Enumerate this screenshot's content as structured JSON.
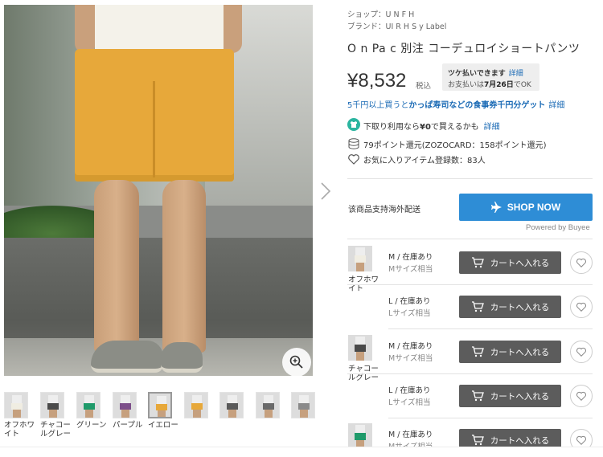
{
  "shop": {
    "label": "ショップ：",
    "value": "U N F H"
  },
  "brand": {
    "label": "ブランド：",
    "value": "UI R H S y Label"
  },
  "product_title": "O n Pa c 別注 コーデュロイショートパンツ",
  "price": "¥8,532",
  "tax_label": "税込",
  "tooltip": {
    "line1": "ツケ払いできます",
    "link": "詳細",
    "line2_prefix": "お支払いは",
    "line2_date": "7月26日",
    "line2_suffix": "でOK"
  },
  "promo": {
    "text_a": "5千円以上買うと",
    "text_b": "かっぱ寿司などの食事券千円分ゲット",
    "link": "詳細"
  },
  "trade_in": {
    "text": "下取り利用なら",
    "bold": "¥0",
    "text2": "で買えるかも",
    "link": "詳細"
  },
  "points": "79ポイント還元(ZOZOCARD：158ポイント還元)",
  "favorites": "お気に入りアイテム登録数：83人",
  "shipping_text": "该商品支持海外配送",
  "shop_now_label": "SHOP NOW",
  "powered_by": "Powered by Buyee",
  "thumbnails": [
    {
      "label": "オフホワイト",
      "color": "#f0ede2"
    },
    {
      "label": "チャコールグレー",
      "color": "#4a4a4a"
    },
    {
      "label": "グリーン",
      "color": "#1f9a6a"
    },
    {
      "label": "パープル",
      "color": "#7d4f8a"
    },
    {
      "label": "イエロー",
      "color": "#e7a83a"
    },
    {
      "label": "",
      "color": "#e7a83a"
    },
    {
      "label": "",
      "color": "#5a5a5a"
    },
    {
      "label": "",
      "color": "#6a6a6a"
    },
    {
      "label": "",
      "color": "#8a8a8a"
    }
  ],
  "variants": [
    {
      "color": "オフホワイト",
      "size": "M / 在庫あり",
      "sub": "Mサイズ相当",
      "cart": "カートへ入れる",
      "swatch": "#f0ede2"
    },
    {
      "color": "",
      "size": "L / 在庫あり",
      "sub": "Lサイズ相当",
      "cart": "カートへ入れる",
      "swatch": ""
    },
    {
      "color": "チャコールグレー",
      "size": "M / 在庫あり",
      "sub": "Mサイズ相当",
      "cart": "カートへ入れる",
      "swatch": "#4a4a4a"
    },
    {
      "color": "",
      "size": "L / 在庫あり",
      "sub": "Lサイズ相当",
      "cart": "カートへ入れる",
      "swatch": ""
    },
    {
      "color": "",
      "size": "M / 在庫あり",
      "sub": "Mサイズ相当",
      "cart": "カートへ入れる",
      "swatch": "#1f9a6a"
    }
  ],
  "colors": {
    "link": "#1a6ab5",
    "shop_now": "#2e8dd6",
    "cart": "#5c5c5c",
    "trade_in_icon": "#2bb5a0"
  },
  "icons": {
    "zoom": "zoom-in-icon",
    "next": "chevron-right-icon",
    "cart": "cart-icon",
    "heart": "heart-icon",
    "plane": "airplane-icon",
    "shirt": "shirt-icon",
    "coins": "coins-icon"
  }
}
